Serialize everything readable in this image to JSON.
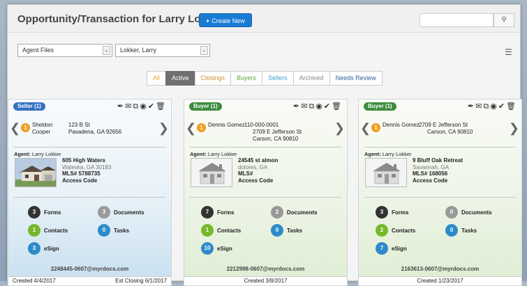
{
  "header": {
    "title": "Opportunity/Transaction for Larry Lokker",
    "create_label": "Create New",
    "search_placeholder": ""
  },
  "filters": {
    "type_value": "Agent Files",
    "agent_value": "Lokker, Larry"
  },
  "tabs": [
    {
      "label": "All",
      "color": "#e8a33a"
    },
    {
      "label": "Active",
      "color": "#ffffff"
    },
    {
      "label": "Closings",
      "color": "#d08a2a"
    },
    {
      "label": "Buyers",
      "color": "#5aa93a"
    },
    {
      "label": "Sellers",
      "color": "#3ba3c9"
    },
    {
      "label": "Archived",
      "color": "#888888"
    },
    {
      "label": "Needs Review",
      "color": "#2f5f9e"
    }
  ],
  "cards": [
    {
      "badge": "Seller (1)",
      "count": "1",
      "contact_line1": "Sheldon",
      "contact_line2": "Cooper",
      "addr_line1": "123 B St",
      "addr_line2": "Pasadena, GA 92656",
      "addr_line3": "",
      "agent_label": "Agent:",
      "agent_name": "Larry Lokker",
      "prop_name": "605 High Waters",
      "prop_city": "Waleska, GA 30183",
      "mls": "MLS# 5788735",
      "access": "Access Code",
      "forms": "3",
      "forms_label": "Forms",
      "documents": "3",
      "documents_label": "Documents",
      "contacts": "1",
      "contacts_label": "Contacts",
      "tasks": "0",
      "tasks_label": "Tasks",
      "esign": "3",
      "esign_label": "eSign",
      "email": "2248445-0607@myrdocs.com",
      "created": "Created 4/4/2017",
      "closing": "Est Closing 6/1/2017"
    },
    {
      "badge": "Buyer (1)",
      "count": "1",
      "contact_line1": "Dennis Gomez",
      "contact_line2": "",
      "addr_line1": "110-000-0001",
      "addr_line2": "2709 E Jefferson St",
      "addr_line3": "Carson, CA 90810",
      "agent_label": "Agent:",
      "agent_name": "Larry Lokker",
      "prop_name": "24545 st almon",
      "prop_city": "dolores, GA",
      "mls": "MLS#",
      "access": "Access Code",
      "forms": "7",
      "forms_label": "Forms",
      "documents": "2",
      "documents_label": "Documents",
      "contacts": "1",
      "contacts_label": "Contacts",
      "tasks": "0",
      "tasks_label": "Tasks",
      "esign": "10",
      "esign_label": "eSign",
      "email": "2212998-0607@myrdocs.com",
      "created": "Created 3/8/2017",
      "closing": ""
    },
    {
      "badge": "Buyer (1)",
      "count": "1",
      "contact_line1": "Dennis Gomez",
      "contact_line2": "",
      "addr_line1": "2709 E Jefferson St",
      "addr_line2": "Carson, CA 90810",
      "addr_line3": "",
      "agent_label": "Agent:",
      "agent_name": "Larry Lokker",
      "prop_name": "9 Bluff Oak Retreat",
      "prop_city": "Savannah, GA",
      "mls": "MLS# 168056",
      "access": "Access Code",
      "forms": "3",
      "forms_label": "Forms",
      "documents": "0",
      "documents_label": "Documents",
      "contacts": "2",
      "contacts_label": "Contacts",
      "tasks": "0",
      "tasks_label": "Tasks",
      "esign": "7",
      "esign_label": "eSign",
      "email": "2163613-0607@myrdocs.com",
      "created": "Created 1/23/2017",
      "closing": ""
    }
  ]
}
